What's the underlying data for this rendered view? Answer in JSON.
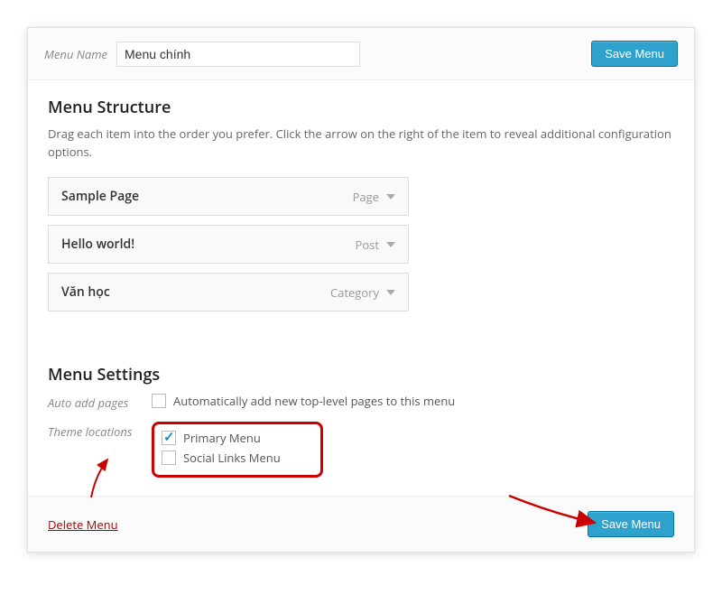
{
  "header": {
    "menu_name_label": "Menu Name",
    "menu_name_value": "Menu chính",
    "save_button": "Save Menu"
  },
  "structure": {
    "title": "Menu Structure",
    "description": "Drag each item into the order you prefer. Click the arrow on the right of the item to reveal additional configuration options.",
    "items": [
      {
        "title": "Sample Page",
        "type": "Page"
      },
      {
        "title": "Hello world!",
        "type": "Post"
      },
      {
        "title": "Văn học",
        "type": "Category"
      }
    ]
  },
  "settings": {
    "title": "Menu Settings",
    "auto_add_label": "Auto add pages",
    "auto_add_text": "Automatically add new top-level pages to this menu",
    "theme_locations_label": "Theme locations",
    "locations": [
      {
        "label": "Primary Menu",
        "checked": true
      },
      {
        "label": "Social Links Menu",
        "checked": false
      }
    ]
  },
  "footer": {
    "delete_link": "Delete Menu",
    "save_button": "Save Menu"
  }
}
